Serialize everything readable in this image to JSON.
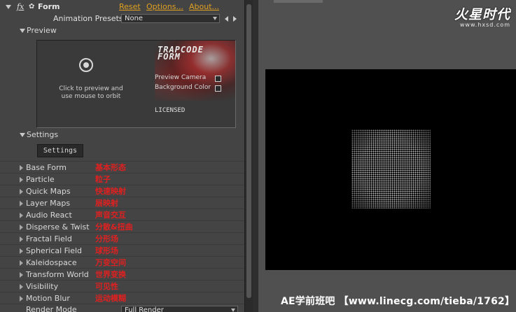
{
  "effect_header": {
    "fx_label": "fx",
    "name": "Form",
    "links": {
      "reset": "Reset",
      "options": "Options...",
      "about": "About..."
    }
  },
  "presets": {
    "label": "Animation Presets:",
    "value": "None"
  },
  "preview": {
    "section_label": "Preview",
    "logo_text": "TRAPCODE FORM",
    "orbit_caption": "Click to preview and use mouse to orbit",
    "camera_option": "Preview Camera",
    "camera_checked": false,
    "background_option": "Background Color",
    "background_checked": false,
    "license_status": "LICENSED"
  },
  "settings": {
    "section_label": "Settings",
    "button_label": "Settings"
  },
  "groups": [
    {
      "label": "Base Form",
      "note": "基本形态"
    },
    {
      "label": "Particle",
      "note": "粒子"
    },
    {
      "label": "Quick Maps",
      "note": "快速映射"
    },
    {
      "label": "Layer Maps",
      "note": "层映射"
    },
    {
      "label": "Audio React",
      "note": "声音交互"
    },
    {
      "label": "Disperse & Twist",
      "note": "分散&扭曲"
    },
    {
      "label": "Fractal Field",
      "note": "分形场"
    },
    {
      "label": "Spherical Field",
      "note": "球形场"
    },
    {
      "label": "Kaleidospace",
      "note": "万变空间"
    },
    {
      "label": "Transform World",
      "note": "世界变换"
    },
    {
      "label": "Visibility",
      "note": "可见性"
    },
    {
      "label": "Motion Blur",
      "note": "运动模糊"
    }
  ],
  "render_mode": {
    "label": "Render Mode",
    "value": "Full Render"
  },
  "site_logo": {
    "title": "火星时代",
    "url": "www.hxsd.com"
  },
  "watermark": "AE学前班吧 【www.linecg.com/tieba/1762】",
  "colors": {
    "link": "#e0a020",
    "annotation": "#e02020",
    "viewer_bg": "#000000"
  }
}
